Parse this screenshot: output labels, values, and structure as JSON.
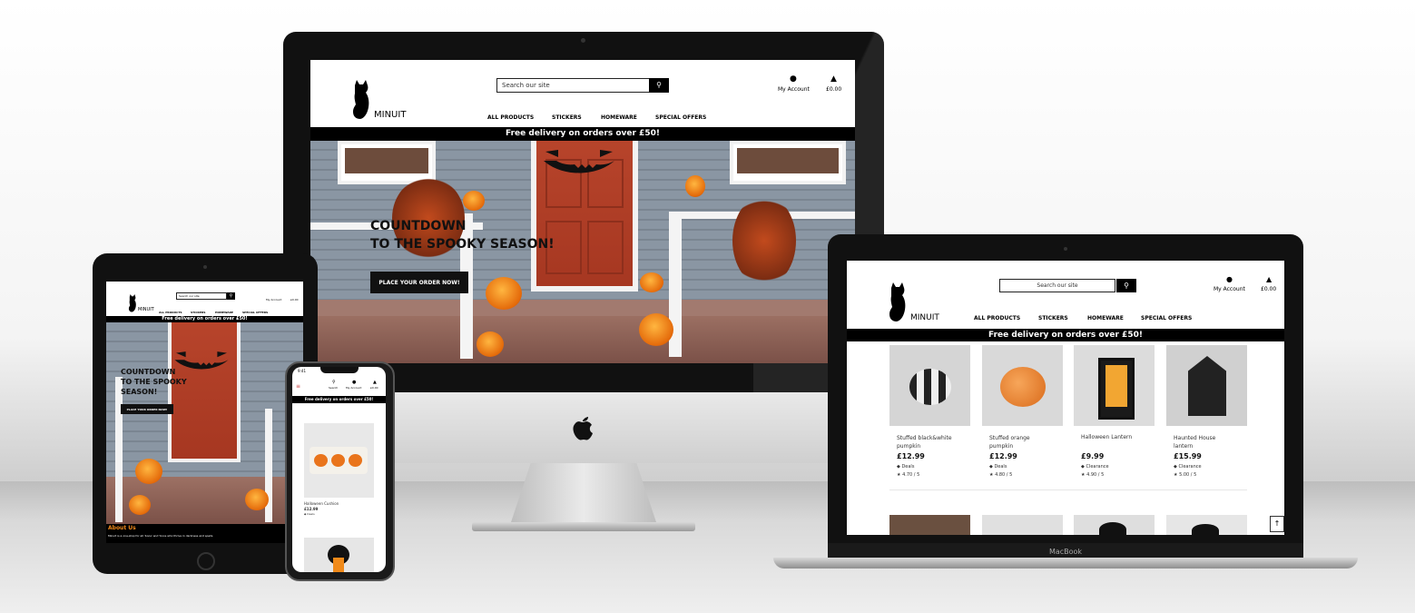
{
  "brand": {
    "name": "MINUIT"
  },
  "search": {
    "placeholder": "Search our site"
  },
  "account": {
    "label": "My Account",
    "basket": "£0.00"
  },
  "nav": [
    "ALL PRODUCTS",
    "STICKERS",
    "HOMEWARE",
    "SPECIAL OFFERS"
  ],
  "banner": "Free delivery on orders over £50!",
  "hero": {
    "line1": "COUNTDOWN",
    "line2": "TO THE SPOOKY SEASON!",
    "tablet_line1": "COUNTDOWN",
    "tablet_line2": "TO THE SPOOKY",
    "tablet_line3": "SEASON!",
    "cta": "PLACE YOUR ORDER NOW!"
  },
  "products": [
    {
      "name": "Stuffed black&white pumpkin",
      "price": "£12.99",
      "tag": "Deals",
      "rating": "4.70 / 5"
    },
    {
      "name": "Stuffed orange pumpkin",
      "price": "£12.99",
      "tag": "Deals",
      "rating": "4.80 / 5"
    },
    {
      "name": "Halloween Lantern",
      "price": "£9.99",
      "tag": "Clearance",
      "rating": "4.90 / 5"
    },
    {
      "name": "Haunted House lantern",
      "price": "£15.99",
      "tag": "Clearance",
      "rating": "5.00 / 5"
    }
  ],
  "phone": {
    "time": "9:41",
    "search_label": "Search",
    "product_name": "Halloween Cushion",
    "product_price": "£12.99"
  },
  "about": {
    "title": "About Us",
    "text": "Minuit is a one-stop for all 'boos' and 'boos who thrive in darkness and spells"
  },
  "laptop_label": "MacBook",
  "colors": {
    "accent": "#000000",
    "about_title": "#f0891a",
    "bg": "#ffffff"
  }
}
